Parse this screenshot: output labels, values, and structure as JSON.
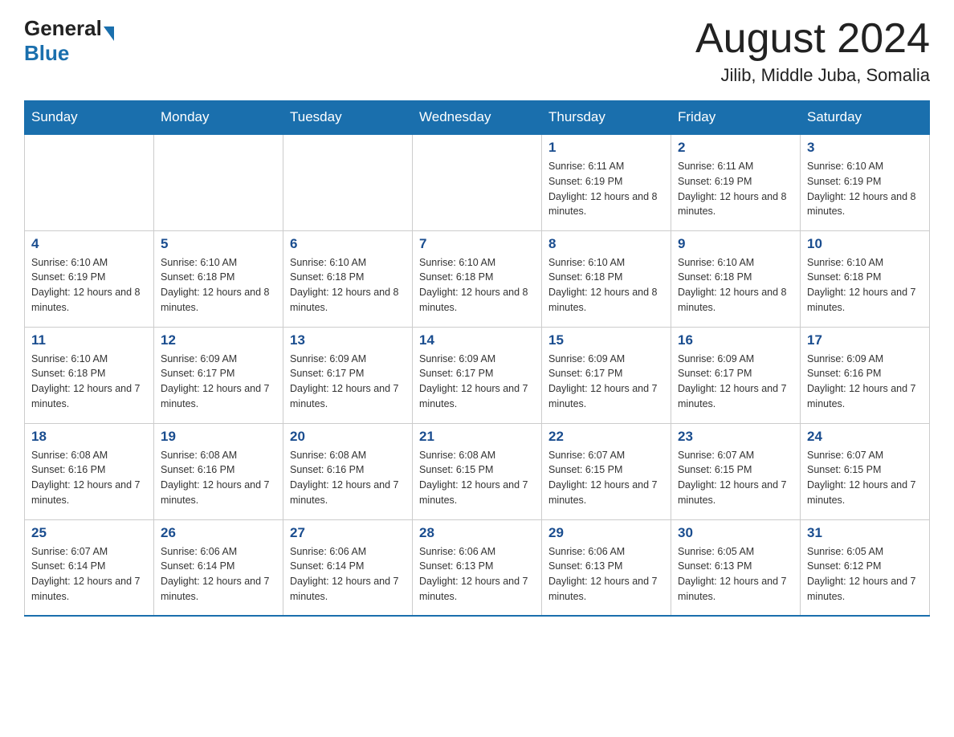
{
  "header": {
    "logo_general": "General",
    "logo_blue": "Blue",
    "month_year": "August 2024",
    "location": "Jilib, Middle Juba, Somalia"
  },
  "days_of_week": [
    "Sunday",
    "Monday",
    "Tuesday",
    "Wednesday",
    "Thursday",
    "Friday",
    "Saturday"
  ],
  "weeks": [
    [
      {
        "day": "",
        "info": ""
      },
      {
        "day": "",
        "info": ""
      },
      {
        "day": "",
        "info": ""
      },
      {
        "day": "",
        "info": ""
      },
      {
        "day": "1",
        "info": "Sunrise: 6:11 AM\nSunset: 6:19 PM\nDaylight: 12 hours and 8 minutes."
      },
      {
        "day": "2",
        "info": "Sunrise: 6:11 AM\nSunset: 6:19 PM\nDaylight: 12 hours and 8 minutes."
      },
      {
        "day": "3",
        "info": "Sunrise: 6:10 AM\nSunset: 6:19 PM\nDaylight: 12 hours and 8 minutes."
      }
    ],
    [
      {
        "day": "4",
        "info": "Sunrise: 6:10 AM\nSunset: 6:19 PM\nDaylight: 12 hours and 8 minutes."
      },
      {
        "day": "5",
        "info": "Sunrise: 6:10 AM\nSunset: 6:18 PM\nDaylight: 12 hours and 8 minutes."
      },
      {
        "day": "6",
        "info": "Sunrise: 6:10 AM\nSunset: 6:18 PM\nDaylight: 12 hours and 8 minutes."
      },
      {
        "day": "7",
        "info": "Sunrise: 6:10 AM\nSunset: 6:18 PM\nDaylight: 12 hours and 8 minutes."
      },
      {
        "day": "8",
        "info": "Sunrise: 6:10 AM\nSunset: 6:18 PM\nDaylight: 12 hours and 8 minutes."
      },
      {
        "day": "9",
        "info": "Sunrise: 6:10 AM\nSunset: 6:18 PM\nDaylight: 12 hours and 8 minutes."
      },
      {
        "day": "10",
        "info": "Sunrise: 6:10 AM\nSunset: 6:18 PM\nDaylight: 12 hours and 7 minutes."
      }
    ],
    [
      {
        "day": "11",
        "info": "Sunrise: 6:10 AM\nSunset: 6:18 PM\nDaylight: 12 hours and 7 minutes."
      },
      {
        "day": "12",
        "info": "Sunrise: 6:09 AM\nSunset: 6:17 PM\nDaylight: 12 hours and 7 minutes."
      },
      {
        "day": "13",
        "info": "Sunrise: 6:09 AM\nSunset: 6:17 PM\nDaylight: 12 hours and 7 minutes."
      },
      {
        "day": "14",
        "info": "Sunrise: 6:09 AM\nSunset: 6:17 PM\nDaylight: 12 hours and 7 minutes."
      },
      {
        "day": "15",
        "info": "Sunrise: 6:09 AM\nSunset: 6:17 PM\nDaylight: 12 hours and 7 minutes."
      },
      {
        "day": "16",
        "info": "Sunrise: 6:09 AM\nSunset: 6:17 PM\nDaylight: 12 hours and 7 minutes."
      },
      {
        "day": "17",
        "info": "Sunrise: 6:09 AM\nSunset: 6:16 PM\nDaylight: 12 hours and 7 minutes."
      }
    ],
    [
      {
        "day": "18",
        "info": "Sunrise: 6:08 AM\nSunset: 6:16 PM\nDaylight: 12 hours and 7 minutes."
      },
      {
        "day": "19",
        "info": "Sunrise: 6:08 AM\nSunset: 6:16 PM\nDaylight: 12 hours and 7 minutes."
      },
      {
        "day": "20",
        "info": "Sunrise: 6:08 AM\nSunset: 6:16 PM\nDaylight: 12 hours and 7 minutes."
      },
      {
        "day": "21",
        "info": "Sunrise: 6:08 AM\nSunset: 6:15 PM\nDaylight: 12 hours and 7 minutes."
      },
      {
        "day": "22",
        "info": "Sunrise: 6:07 AM\nSunset: 6:15 PM\nDaylight: 12 hours and 7 minutes."
      },
      {
        "day": "23",
        "info": "Sunrise: 6:07 AM\nSunset: 6:15 PM\nDaylight: 12 hours and 7 minutes."
      },
      {
        "day": "24",
        "info": "Sunrise: 6:07 AM\nSunset: 6:15 PM\nDaylight: 12 hours and 7 minutes."
      }
    ],
    [
      {
        "day": "25",
        "info": "Sunrise: 6:07 AM\nSunset: 6:14 PM\nDaylight: 12 hours and 7 minutes."
      },
      {
        "day": "26",
        "info": "Sunrise: 6:06 AM\nSunset: 6:14 PM\nDaylight: 12 hours and 7 minutes."
      },
      {
        "day": "27",
        "info": "Sunrise: 6:06 AM\nSunset: 6:14 PM\nDaylight: 12 hours and 7 minutes."
      },
      {
        "day": "28",
        "info": "Sunrise: 6:06 AM\nSunset: 6:13 PM\nDaylight: 12 hours and 7 minutes."
      },
      {
        "day": "29",
        "info": "Sunrise: 6:06 AM\nSunset: 6:13 PM\nDaylight: 12 hours and 7 minutes."
      },
      {
        "day": "30",
        "info": "Sunrise: 6:05 AM\nSunset: 6:13 PM\nDaylight: 12 hours and 7 minutes."
      },
      {
        "day": "31",
        "info": "Sunrise: 6:05 AM\nSunset: 6:12 PM\nDaylight: 12 hours and 7 minutes."
      }
    ]
  ]
}
